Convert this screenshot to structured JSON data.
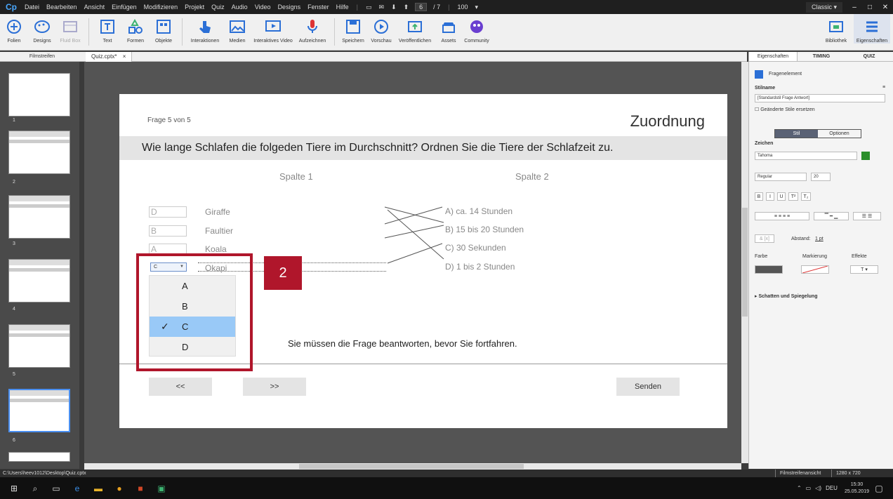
{
  "menubar": {
    "logo": "Cp",
    "items": [
      "Datei",
      "Bearbeiten",
      "Ansicht",
      "Einfügen",
      "Modifizieren",
      "Projekt",
      "Quiz",
      "Audio",
      "Video",
      "Designs",
      "Fenster",
      "Hilfe"
    ],
    "current_page": "6",
    "total_pages": "/ 7",
    "zoom": "100",
    "workspace": "Classic"
  },
  "toolbar": {
    "items": [
      "Folien",
      "Designs",
      "Fluid Box",
      "Text",
      "Formen",
      "Objekte",
      "Interaktionen",
      "Medien",
      "Interaktives Video",
      "Aufzeichnen",
      "Speichern",
      "Vorschau",
      "Veröffentlichen",
      "Assets",
      "Community"
    ],
    "right_items": [
      "Bibliothek",
      "Eigenschaften"
    ]
  },
  "filmstrip": {
    "title": "Filmstreifen",
    "slide_numbers": [
      "1",
      "2",
      "3",
      "4",
      "5",
      "6"
    ]
  },
  "doctab": {
    "label": "Quiz.cptx*",
    "close": "×"
  },
  "slide": {
    "counter": "Frage 5 von 5",
    "type_title": "Zuordnung",
    "question": "Wie lange Schlafen die folgeden Tiere im Durchschnitt? Ordnen Sie die Tiere der Schlafzeit zu.",
    "column1_title": "Spalte 1",
    "column2_title": "Spalte 2",
    "column1": [
      {
        "answer": "D",
        "label": "Giraffe"
      },
      {
        "answer": "B",
        "label": "Faultier"
      },
      {
        "answer": "A",
        "label": "Koala"
      },
      {
        "answer": "C",
        "label": "Okapi"
      }
    ],
    "column2": [
      "A) ca. 14 Stunden",
      "B) 15 bis 20 Stunden",
      "C) 30 Sekunden",
      "D) 1 bis 2 Stunden"
    ],
    "dropdown_options": [
      "A",
      "B",
      "C",
      "D"
    ],
    "dropdown_selected": "C",
    "callout_number": "2",
    "message": "Sie müssen die Frage beantworten, bevor Sie fortfahren.",
    "btn_prev": "<<",
    "btn_next": ">>",
    "btn_submit": "Senden"
  },
  "props": {
    "tabs": [
      "Eigenschaften",
      "TIMING",
      "QUIZ"
    ],
    "element_name": "Fragenelement",
    "stilname_label": "Stilname",
    "stilname_value": "[Standardstil Frage Antwort]",
    "replace_styles": "Geänderte Stile ersetzen",
    "seg_stil": "Stil",
    "seg_optionen": "Optionen",
    "zeichen_label": "Zeichen",
    "font": "Tahoma",
    "weight": "Regular",
    "size": "20",
    "format_btns": [
      "B",
      "I",
      "U",
      "T²",
      "T₂"
    ],
    "abstand_label": "Abstand:",
    "abstand_value": "1 pt",
    "farbe_label": "Farbe",
    "markierung_label": "Markierung",
    "effekte_label": "Effekte",
    "effekte_value": "T",
    "shadow_label": "Schatten und Spiegelung"
  },
  "statusbar": {
    "path": "C:\\Users\\heev1012\\Desktop\\Quiz.cptx",
    "view": "Filmstreifenansicht",
    "resolution": "1280 x 720"
  },
  "taskbar": {
    "lang": "DEU",
    "time": "15:30",
    "date": "25.05.2019"
  }
}
